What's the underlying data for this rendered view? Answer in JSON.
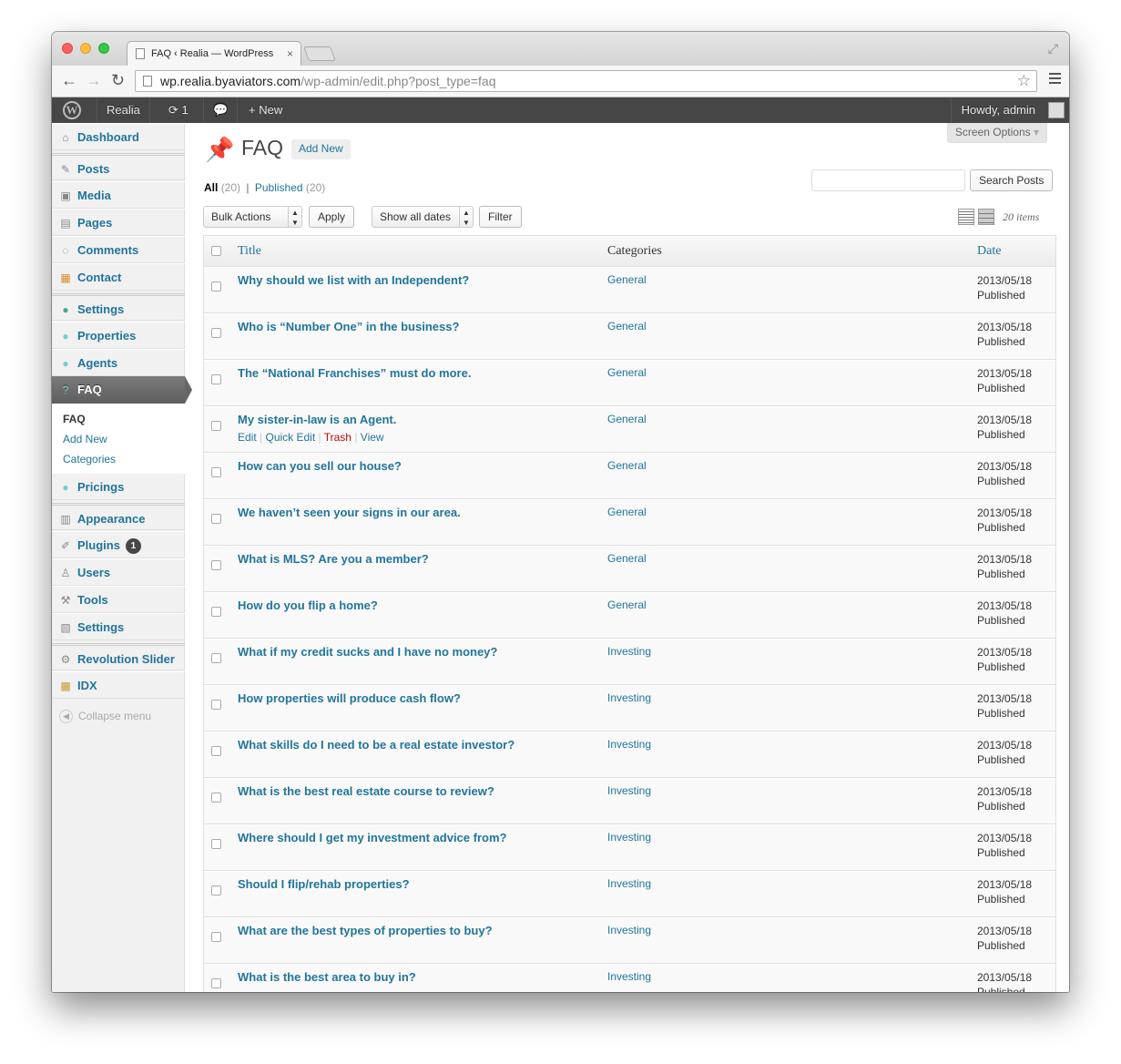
{
  "browser": {
    "tab_title": "FAQ ‹ Realia — WordPress",
    "tab_close": "×",
    "url_host": "wp.realia.byaviators.com",
    "url_path": "/wp-admin/edit.php?post_type=faq"
  },
  "adminbar": {
    "site_name": "Realia",
    "updates_count": "1",
    "new_label": "New",
    "howdy": "Howdy, admin"
  },
  "sidebar": {
    "dashboard": "Dashboard",
    "posts": "Posts",
    "media": "Media",
    "pages": "Pages",
    "comments": "Comments",
    "contact": "Contact",
    "settings_top": "Settings",
    "properties": "Properties",
    "agents": "Agents",
    "faq": "FAQ",
    "sub_faq": "FAQ",
    "sub_add_new": "Add New",
    "sub_categories": "Categories",
    "pricings": "Pricings",
    "appearance": "Appearance",
    "plugins": "Plugins",
    "plugins_badge": "1",
    "users": "Users",
    "tools": "Tools",
    "settings": "Settings",
    "revolution_slider": "Revolution Slider",
    "idx": "IDX",
    "collapse": "Collapse menu"
  },
  "page": {
    "title": "FAQ",
    "add_new": "Add New",
    "screen_options": "Screen Options",
    "filter_all": "All",
    "filter_all_count": "(20)",
    "filter_sep": "|",
    "filter_published": "Published",
    "filter_published_count": "(20)",
    "search_button": "Search Posts",
    "bulk_actions": "Bulk Actions",
    "apply": "Apply",
    "dates": "Show all dates",
    "filter_button": "Filter",
    "items_count": "20 items"
  },
  "table": {
    "col_title": "Title",
    "col_categories": "Categories",
    "col_date": "Date",
    "row_actions": {
      "edit": "Edit",
      "quick_edit": "Quick Edit",
      "trash": "Trash",
      "view": "View"
    },
    "rows": [
      {
        "title": "Why should we list with an Independent?",
        "category": "General",
        "date": "2013/05/18",
        "status": "Published"
      },
      {
        "title": "Who is “Number One” in the business?",
        "category": "General",
        "date": "2013/05/18",
        "status": "Published"
      },
      {
        "title": "The “National Franchises” must do more.",
        "category": "General",
        "date": "2013/05/18",
        "status": "Published"
      },
      {
        "title": "My sister-in-law is an Agent.",
        "category": "General",
        "date": "2013/05/18",
        "status": "Published"
      },
      {
        "title": "How can you sell our house?",
        "category": "General",
        "date": "2013/05/18",
        "status": "Published"
      },
      {
        "title": "We haven’t seen your signs in our area.",
        "category": "General",
        "date": "2013/05/18",
        "status": "Published"
      },
      {
        "title": "What is MLS? Are you a member?",
        "category": "General",
        "date": "2013/05/18",
        "status": "Published"
      },
      {
        "title": "How do you flip a home?",
        "category": "General",
        "date": "2013/05/18",
        "status": "Published"
      },
      {
        "title": "What if my credit sucks and I have no money?",
        "category": "Investing",
        "date": "2013/05/18",
        "status": "Published"
      },
      {
        "title": "How properties will produce cash flow?",
        "category": "Investing",
        "date": "2013/05/18",
        "status": "Published"
      },
      {
        "title": "What skills do I need to be a real estate investor?",
        "category": "Investing",
        "date": "2013/05/18",
        "status": "Published"
      },
      {
        "title": "What is the best real estate course to review?",
        "category": "Investing",
        "date": "2013/05/18",
        "status": "Published"
      },
      {
        "title": "Where should I get my investment advice from?",
        "category": "Investing",
        "date": "2013/05/18",
        "status": "Published"
      },
      {
        "title": "Should I flip/rehab properties?",
        "category": "Investing",
        "date": "2013/05/18",
        "status": "Published"
      },
      {
        "title": "What are the best types of properties to buy?",
        "category": "Investing",
        "date": "2013/05/18",
        "status": "Published"
      },
      {
        "title": "What is the best area to buy in?",
        "category": "Investing",
        "date": "2013/05/18",
        "status": "Published"
      }
    ]
  }
}
